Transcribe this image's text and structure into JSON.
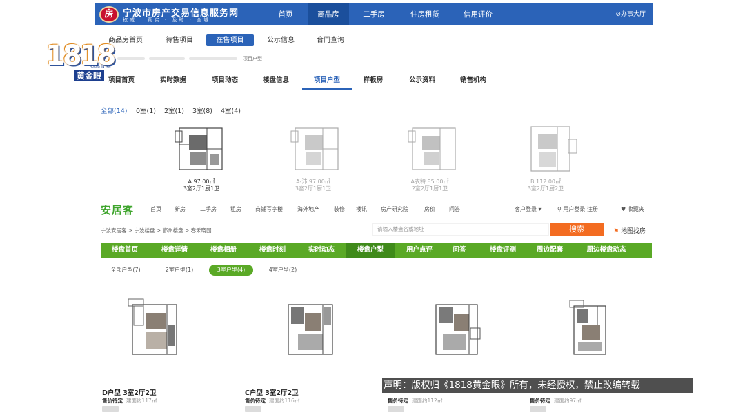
{
  "logo": {
    "number": "1818",
    "tag": "黄金眼",
    "small": "HUANG JIN YAN"
  },
  "ningbo": {
    "logo_mark": "房",
    "title": "宁波市房产交易信息服务网",
    "tagline": "权威 · 真实 · 及时 · 全城",
    "nav": [
      "首页",
      "商品房",
      "二手房",
      "住房租赁",
      "信用评价"
    ],
    "nav_active": 1,
    "office": "⊘办事大厅",
    "sub_tabs": [
      "商品房首页",
      "待售项目",
      "在售项目",
      "公示信息",
      "合同查询"
    ],
    "sub_active": 2,
    "crumb": "项目户型",
    "project_tabs": [
      "项目首页",
      "实时数据",
      "项目动态",
      "楼盘信息",
      "项目户型",
      "样板房",
      "公示资料",
      "销售机构"
    ],
    "project_active": 4,
    "filters": [
      "全部(14)",
      "0室(1)",
      "2室(1)",
      "3室(8)",
      "4室(4)"
    ],
    "filter_active": 0,
    "plans": [
      {
        "name": "A  97.00㎡",
        "desc": "3室2厅1厨1卫"
      },
      {
        "name": "A-沛  97.00㎡",
        "desc": "3室2厅1厨1卫"
      },
      {
        "name": "A衣特  85.00㎡",
        "desc": "2室2厅1厨1卫"
      },
      {
        "name": "B  112.00㎡",
        "desc": "3室2厅1厨2卫"
      }
    ]
  },
  "anjuke": {
    "logo": "安居客",
    "nav": [
      "首页",
      "新房",
      "二手房",
      "租房",
      "商铺写字楼",
      "海外地产",
      "装修",
      "楼讯",
      "房产研究院",
      "房价",
      "问答"
    ],
    "right_links": [
      "客户登录 ▾",
      "用户登录  注册",
      "♥ 收藏夹"
    ],
    "crumb": "宁波安居客 > 宁波楼盘 > 鄞州楼盘 > 春禾晓园",
    "search_placeholder": "请输入楼盘名或地址",
    "search_button": "搜索",
    "map_link": "地图找房",
    "tabs": [
      "楼盘首页",
      "楼盘详情",
      "楼盘相册",
      "楼盘时刻",
      "实时动态",
      "楼盘户型",
      "用户点评",
      "问答",
      "楼盘评测",
      "周边配套",
      "周边楼盘动态"
    ],
    "tab_active": 5,
    "filters": [
      "全部户型(7)",
      "2室户型(1)",
      "3室户型(4)",
      "4室户型(2)"
    ],
    "filter_active": 2,
    "plans": [
      {
        "title": "D户型 3室2厅2卫",
        "price": "售价待定",
        "area": "建面约117㎡"
      },
      {
        "title": "C户型 3室2厅2卫",
        "price": "售价待定",
        "area": "建面约116㎡"
      },
      {
        "title": "",
        "price": "售价待定",
        "area": "建面约112㎡"
      },
      {
        "title": "",
        "price": "售价待定",
        "area": "建面约97㎡"
      }
    ]
  },
  "disclaimer": "声明：版权归《1818黄金眼》所有，未经授权，禁止改编转载"
}
